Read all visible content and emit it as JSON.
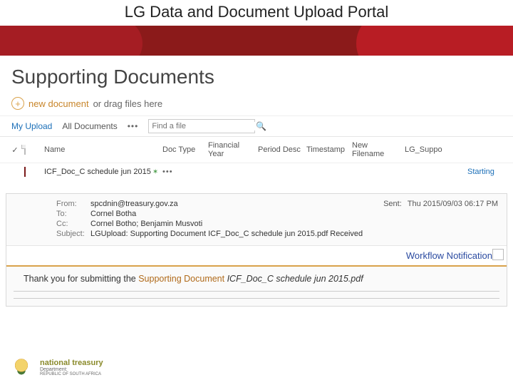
{
  "header": {
    "title": "LG Data and Document Upload Portal"
  },
  "section": {
    "title": "Supporting Documents"
  },
  "newdoc": {
    "label": "new document",
    "hint": "or drag files here"
  },
  "views": {
    "my_upload": "My Upload",
    "all_docs": "All Documents",
    "more": "•••"
  },
  "search": {
    "placeholder": "Find a file"
  },
  "columns": {
    "name": "Name",
    "doctype": "Doc Type",
    "fy": "Financial Year",
    "period": "Period Desc",
    "ts": "Timestamp",
    "newfn": "New Filename",
    "lg": "LG_Suppo"
  },
  "row0": {
    "name": "ICF_Doc_C schedule jun 2015",
    "new": "✶",
    "more": "•••",
    "lg": "Starting"
  },
  "email": {
    "from_label": "From:",
    "from_val": "spcdnin@treasury.gov.za",
    "to_label": "To:",
    "to_val": "Cornel Botha",
    "cc_label": "Cc:",
    "cc_val": "Cornel Botho; Benjamin Musvoti",
    "subj_label": "Subject:",
    "subj_val": "LGUpload: Supporting Document ICF_Doc_C schedule jun 2015.pdf Received",
    "sent_label": "Sent:",
    "sent_val": "Thu 2015/09/03 06:17 PM"
  },
  "workflow": {
    "title": "Workflow Notification"
  },
  "thank": {
    "prefix": "Thank you for submitting the ",
    "mid": "Supporting Document",
    "file": " ICF_Doc_C schedule jun 2015.pdf"
  },
  "footer": {
    "line1": "national treasury",
    "line2": "Department:",
    "line3": "REPUBLIC OF SOUTH AFRICA"
  }
}
